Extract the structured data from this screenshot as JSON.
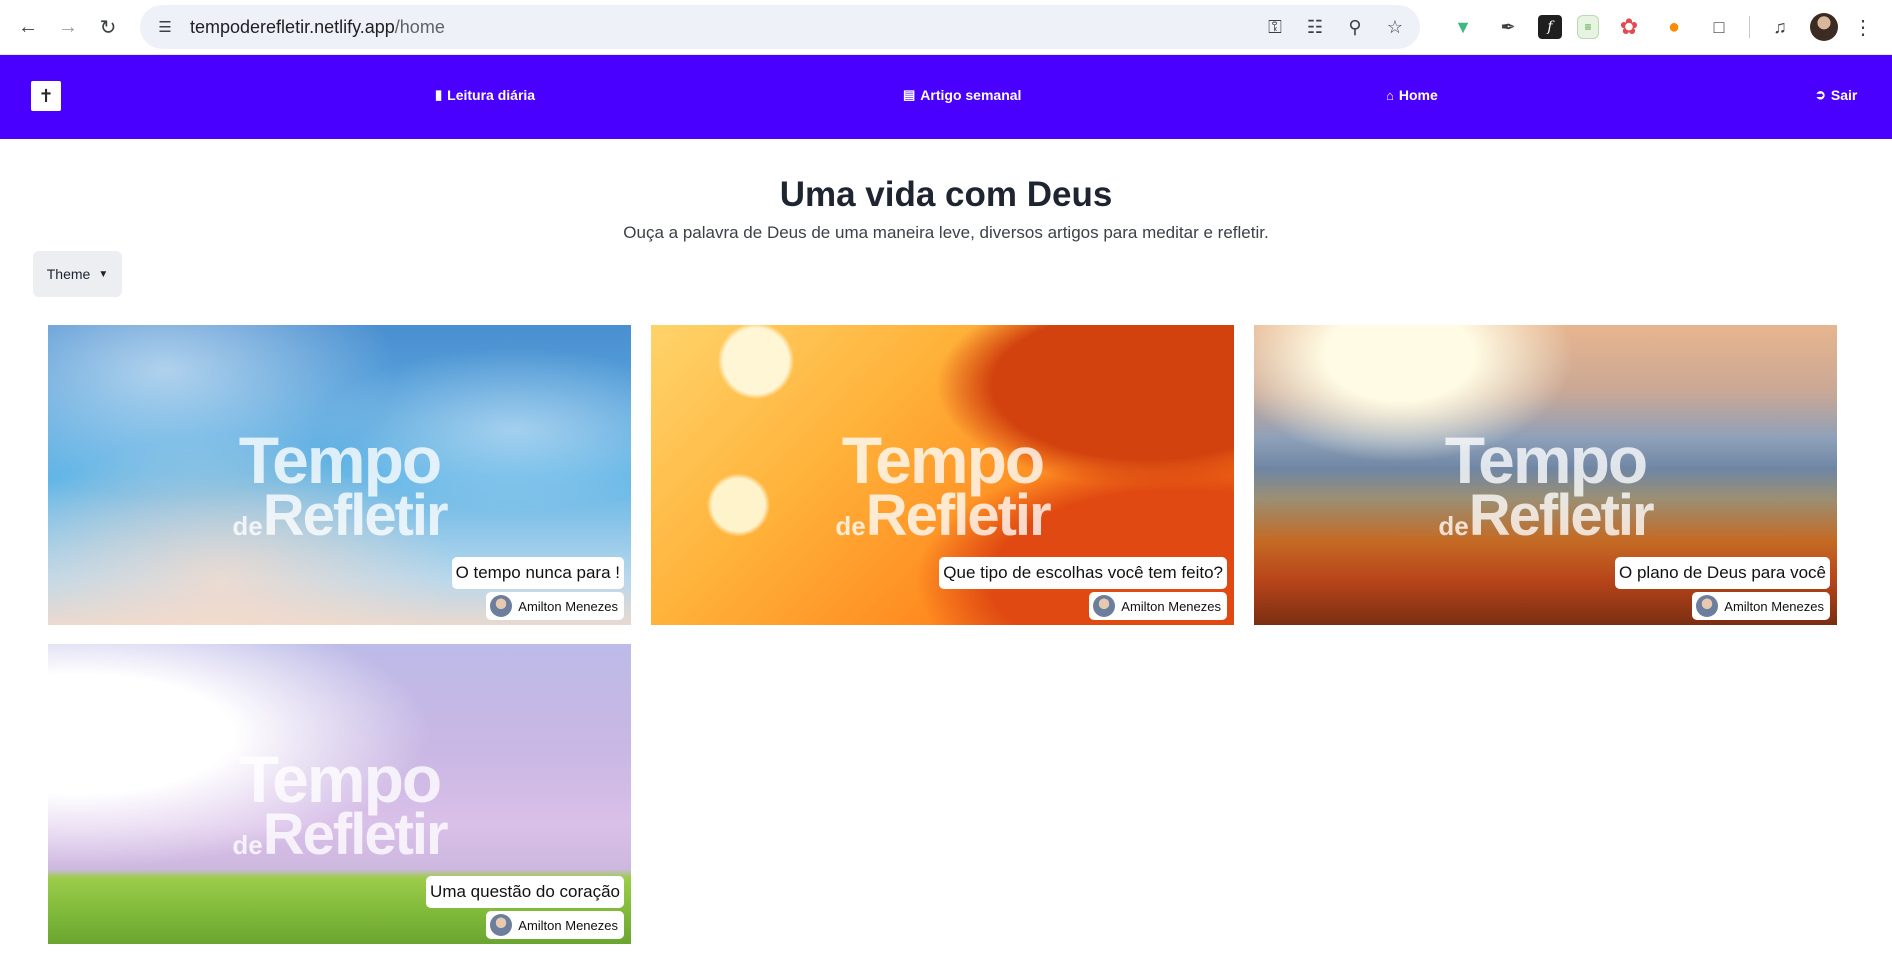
{
  "browser": {
    "url_host": "tempoderefletir.netlify.app",
    "url_path": "/home"
  },
  "navbar": {
    "links": [
      {
        "label": "Leitura diária",
        "icon": "book-icon"
      },
      {
        "label": "Artigo semanal",
        "icon": "newspaper-icon"
      },
      {
        "label": "Home",
        "icon": "home-icon"
      },
      {
        "label": "Sair",
        "icon": "sign-out-icon"
      }
    ]
  },
  "hero": {
    "title": "Uma vida com Deus",
    "subtitle": "Ouça a palavra de Deus de uma maneira leve, diversos artigos para meditar e refletir."
  },
  "theme_button": {
    "label": "Theme"
  },
  "cards": [
    {
      "title": "O tempo nunca para !",
      "author": "Amilton Menezes",
      "brand_line1": "Tempo",
      "brand_de": "de",
      "brand_line2": "Refletir"
    },
    {
      "title": "Que tipo de escolhas você tem feito?",
      "author": "Amilton Menezes",
      "brand_line1": "Tempo",
      "brand_de": "de",
      "brand_line2": "Refletir"
    },
    {
      "title": "O plano de Deus para você",
      "author": "Amilton Menezes",
      "brand_line1": "Tempo",
      "brand_de": "de",
      "brand_line2": "Refletir"
    },
    {
      "title": "Uma questão do coração",
      "author": "Amilton Menezes",
      "brand_line1": "Tempo",
      "brand_de": "de",
      "brand_line2": "Refletir"
    }
  ],
  "colors": {
    "navbar_bg": "#4a00ff",
    "title_text": "#1e2530"
  }
}
